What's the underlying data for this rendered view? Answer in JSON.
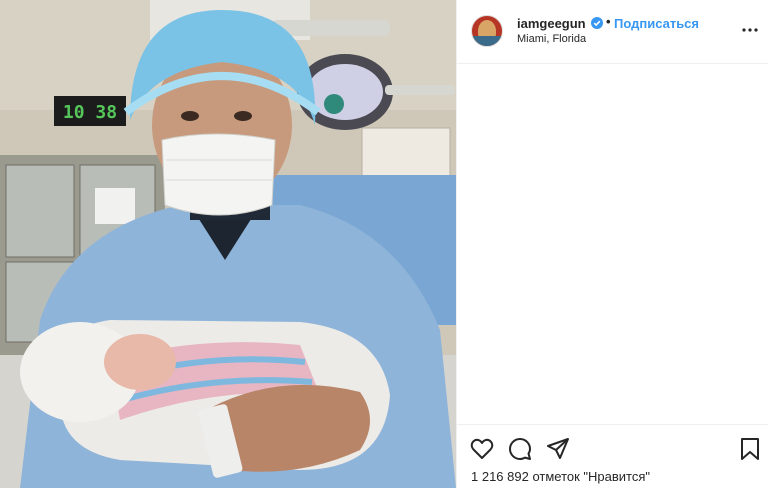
{
  "post": {
    "username": "iamgeegun",
    "follow_label": "Подписаться",
    "separator": "•",
    "location": "Miami, Florida",
    "likes_text": "1 216 892 отметок \"Нравится\""
  },
  "photo": {
    "clock_text": "10 38"
  },
  "icons": {
    "verified": "verified-badge-icon",
    "more": "more-options-icon",
    "like": "heart-icon",
    "comment": "comment-icon",
    "share": "share-icon",
    "save": "bookmark-icon"
  },
  "colors": {
    "link": "#3897f0",
    "text": "#262626",
    "divider": "#efefef"
  }
}
